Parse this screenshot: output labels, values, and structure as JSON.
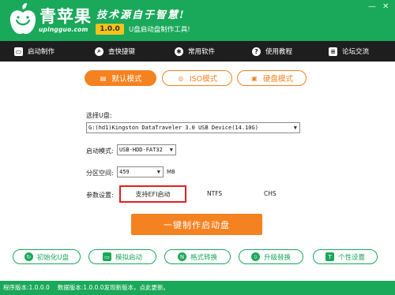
{
  "header": {
    "brand_title": "青苹果",
    "brand_sub": "upingguo.com",
    "slogan": "技术源自于智慧!",
    "version": "1.0.0",
    "version_desc": "U盘启动盘制作工具!",
    "min_label": "—",
    "close_label": "✕"
  },
  "nav": {
    "items": [
      {
        "label": "启动制作",
        "icon": "usb-icon"
      },
      {
        "label": "查快捷键",
        "icon": "search-icon"
      },
      {
        "label": "常用软件",
        "icon": "gear-icon"
      },
      {
        "label": "使用教程",
        "icon": "help-icon"
      },
      {
        "label": "论坛交流",
        "icon": "chat-icon"
      }
    ]
  },
  "modes": {
    "items": [
      {
        "label": "默认模式",
        "icon": "usb-icon",
        "active": true
      },
      {
        "label": "ISO模式",
        "icon": "disc-icon",
        "active": false
      },
      {
        "label": "硬盘模式",
        "icon": "harddisk-icon",
        "active": false
      }
    ]
  },
  "form": {
    "disk_label": "选择U盘:",
    "disk_value": "G:(hd1)Kingston DataTraveler 3.0 USB Device(14.10G)",
    "boot_mode_label": "启动模式:",
    "boot_mode_value": "USB-HDD-FAT32",
    "partition_label": "分区空间:",
    "partition_value": "459",
    "partition_unit": "MB",
    "params_label": "参数设置:",
    "param_efi": "支持EFI启动",
    "param_ntfs": "NTFS",
    "param_chs": "CHS"
  },
  "make_button": "一键制作启动盘",
  "tools": {
    "items": [
      {
        "label": "初始化U盘",
        "icon": "refresh-icon"
      },
      {
        "label": "模拟启动",
        "icon": "monitor-icon"
      },
      {
        "label": "格式转换",
        "icon": "convert-icon"
      },
      {
        "label": "升级替换",
        "icon": "upgrade-icon"
      },
      {
        "label": "个性设置",
        "icon": "shirt-icon"
      }
    ]
  },
  "status": {
    "program_version": "程序版本:1.0.0.0",
    "data_version": "数据版本:1.0.0.0",
    "update_msg": "发现新版本，点此更新。"
  },
  "colors": {
    "brand_green": "#1aa85a",
    "accent_orange": "#f58220",
    "nav_dark": "#1e1e1e",
    "highlight_red": "#e02020"
  }
}
